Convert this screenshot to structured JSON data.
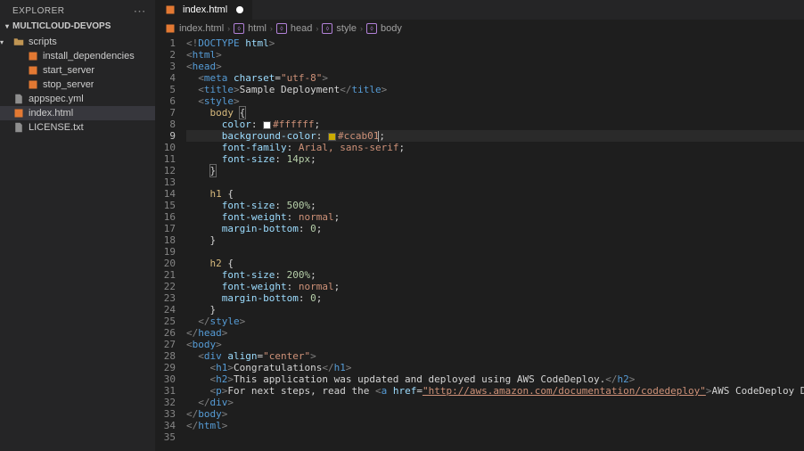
{
  "sidebar": {
    "title": "EXPLORER",
    "section": "MULTICLOUD-DEVOPS",
    "items": [
      {
        "name": "scripts",
        "type": "folder",
        "depth": 0,
        "expanded": true
      },
      {
        "name": "install_dependencies",
        "type": "file",
        "icon": "file",
        "depth": 1
      },
      {
        "name": "start_server",
        "type": "file",
        "icon": "file",
        "depth": 1
      },
      {
        "name": "stop_server",
        "type": "file",
        "icon": "file",
        "depth": 1
      },
      {
        "name": "appspec.yml",
        "type": "file",
        "icon": "yml",
        "depth": 0
      },
      {
        "name": "index.html",
        "type": "file",
        "icon": "file",
        "depth": 0,
        "active": true
      },
      {
        "name": "LICENSE.txt",
        "type": "file",
        "icon": "lic",
        "depth": 0
      }
    ]
  },
  "tab": {
    "label": "index.html"
  },
  "breadcrumbs": [
    {
      "label": "index.html",
      "icon": "file"
    },
    {
      "label": "html",
      "icon": "sym"
    },
    {
      "label": "head",
      "icon": "sym"
    },
    {
      "label": "style",
      "icon": "sym"
    },
    {
      "label": "body",
      "icon": "sym"
    }
  ],
  "colors": {
    "white": "#ffffff",
    "accent": "#ccab01"
  },
  "code_text": {
    "title": "Sample Deployment",
    "h1_txt": "Congratulations",
    "h2_txt": "This application was updated and deployed using AWS CodeDeploy.",
    "p_prefix": "For next steps, read the ",
    "link_url": "http://aws.amazon.com/documentation/codedeploy",
    "link_txt": "AWS CodeDeploy Documentation",
    "font_family": "Arial, sans-serif",
    "font_size": "14px",
    "h1_size": "500%",
    "h2_size": "200%"
  },
  "line_count": 35,
  "current_line": 9
}
